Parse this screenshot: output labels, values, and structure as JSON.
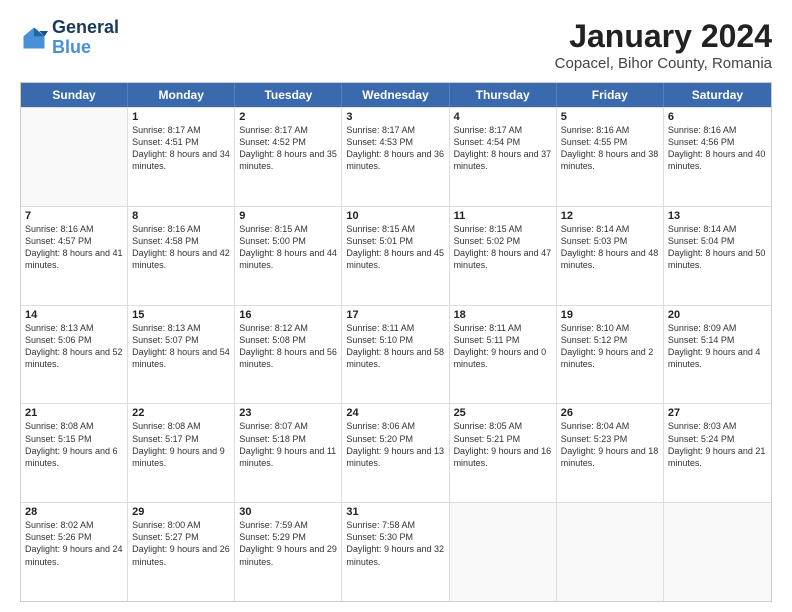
{
  "logo": {
    "line1": "General",
    "line2": "Blue"
  },
  "title": "January 2024",
  "subtitle": "Copacel, Bihor County, Romania",
  "header_days": [
    "Sunday",
    "Monday",
    "Tuesday",
    "Wednesday",
    "Thursday",
    "Friday",
    "Saturday"
  ],
  "weeks": [
    [
      {
        "day": "",
        "sunrise": "",
        "sunset": "",
        "daylight": ""
      },
      {
        "day": "1",
        "sunrise": "Sunrise: 8:17 AM",
        "sunset": "Sunset: 4:51 PM",
        "daylight": "Daylight: 8 hours and 34 minutes."
      },
      {
        "day": "2",
        "sunrise": "Sunrise: 8:17 AM",
        "sunset": "Sunset: 4:52 PM",
        "daylight": "Daylight: 8 hours and 35 minutes."
      },
      {
        "day": "3",
        "sunrise": "Sunrise: 8:17 AM",
        "sunset": "Sunset: 4:53 PM",
        "daylight": "Daylight: 8 hours and 36 minutes."
      },
      {
        "day": "4",
        "sunrise": "Sunrise: 8:17 AM",
        "sunset": "Sunset: 4:54 PM",
        "daylight": "Daylight: 8 hours and 37 minutes."
      },
      {
        "day": "5",
        "sunrise": "Sunrise: 8:16 AM",
        "sunset": "Sunset: 4:55 PM",
        "daylight": "Daylight: 8 hours and 38 minutes."
      },
      {
        "day": "6",
        "sunrise": "Sunrise: 8:16 AM",
        "sunset": "Sunset: 4:56 PM",
        "daylight": "Daylight: 8 hours and 40 minutes."
      }
    ],
    [
      {
        "day": "7",
        "sunrise": "Sunrise: 8:16 AM",
        "sunset": "Sunset: 4:57 PM",
        "daylight": "Daylight: 8 hours and 41 minutes."
      },
      {
        "day": "8",
        "sunrise": "Sunrise: 8:16 AM",
        "sunset": "Sunset: 4:58 PM",
        "daylight": "Daylight: 8 hours and 42 minutes."
      },
      {
        "day": "9",
        "sunrise": "Sunrise: 8:15 AM",
        "sunset": "Sunset: 5:00 PM",
        "daylight": "Daylight: 8 hours and 44 minutes."
      },
      {
        "day": "10",
        "sunrise": "Sunrise: 8:15 AM",
        "sunset": "Sunset: 5:01 PM",
        "daylight": "Daylight: 8 hours and 45 minutes."
      },
      {
        "day": "11",
        "sunrise": "Sunrise: 8:15 AM",
        "sunset": "Sunset: 5:02 PM",
        "daylight": "Daylight: 8 hours and 47 minutes."
      },
      {
        "day": "12",
        "sunrise": "Sunrise: 8:14 AM",
        "sunset": "Sunset: 5:03 PM",
        "daylight": "Daylight: 8 hours and 48 minutes."
      },
      {
        "day": "13",
        "sunrise": "Sunrise: 8:14 AM",
        "sunset": "Sunset: 5:04 PM",
        "daylight": "Daylight: 8 hours and 50 minutes."
      }
    ],
    [
      {
        "day": "14",
        "sunrise": "Sunrise: 8:13 AM",
        "sunset": "Sunset: 5:06 PM",
        "daylight": "Daylight: 8 hours and 52 minutes."
      },
      {
        "day": "15",
        "sunrise": "Sunrise: 8:13 AM",
        "sunset": "Sunset: 5:07 PM",
        "daylight": "Daylight: 8 hours and 54 minutes."
      },
      {
        "day": "16",
        "sunrise": "Sunrise: 8:12 AM",
        "sunset": "Sunset: 5:08 PM",
        "daylight": "Daylight: 8 hours and 56 minutes."
      },
      {
        "day": "17",
        "sunrise": "Sunrise: 8:11 AM",
        "sunset": "Sunset: 5:10 PM",
        "daylight": "Daylight: 8 hours and 58 minutes."
      },
      {
        "day": "18",
        "sunrise": "Sunrise: 8:11 AM",
        "sunset": "Sunset: 5:11 PM",
        "daylight": "Daylight: 9 hours and 0 minutes."
      },
      {
        "day": "19",
        "sunrise": "Sunrise: 8:10 AM",
        "sunset": "Sunset: 5:12 PM",
        "daylight": "Daylight: 9 hours and 2 minutes."
      },
      {
        "day": "20",
        "sunrise": "Sunrise: 8:09 AM",
        "sunset": "Sunset: 5:14 PM",
        "daylight": "Daylight: 9 hours and 4 minutes."
      }
    ],
    [
      {
        "day": "21",
        "sunrise": "Sunrise: 8:08 AM",
        "sunset": "Sunset: 5:15 PM",
        "daylight": "Daylight: 9 hours and 6 minutes."
      },
      {
        "day": "22",
        "sunrise": "Sunrise: 8:08 AM",
        "sunset": "Sunset: 5:17 PM",
        "daylight": "Daylight: 9 hours and 9 minutes."
      },
      {
        "day": "23",
        "sunrise": "Sunrise: 8:07 AM",
        "sunset": "Sunset: 5:18 PM",
        "daylight": "Daylight: 9 hours and 11 minutes."
      },
      {
        "day": "24",
        "sunrise": "Sunrise: 8:06 AM",
        "sunset": "Sunset: 5:20 PM",
        "daylight": "Daylight: 9 hours and 13 minutes."
      },
      {
        "day": "25",
        "sunrise": "Sunrise: 8:05 AM",
        "sunset": "Sunset: 5:21 PM",
        "daylight": "Daylight: 9 hours and 16 minutes."
      },
      {
        "day": "26",
        "sunrise": "Sunrise: 8:04 AM",
        "sunset": "Sunset: 5:23 PM",
        "daylight": "Daylight: 9 hours and 18 minutes."
      },
      {
        "day": "27",
        "sunrise": "Sunrise: 8:03 AM",
        "sunset": "Sunset: 5:24 PM",
        "daylight": "Daylight: 9 hours and 21 minutes."
      }
    ],
    [
      {
        "day": "28",
        "sunrise": "Sunrise: 8:02 AM",
        "sunset": "Sunset: 5:26 PM",
        "daylight": "Daylight: 9 hours and 24 minutes."
      },
      {
        "day": "29",
        "sunrise": "Sunrise: 8:00 AM",
        "sunset": "Sunset: 5:27 PM",
        "daylight": "Daylight: 9 hours and 26 minutes."
      },
      {
        "day": "30",
        "sunrise": "Sunrise: 7:59 AM",
        "sunset": "Sunset: 5:29 PM",
        "daylight": "Daylight: 9 hours and 29 minutes."
      },
      {
        "day": "31",
        "sunrise": "Sunrise: 7:58 AM",
        "sunset": "Sunset: 5:30 PM",
        "daylight": "Daylight: 9 hours and 32 minutes."
      },
      {
        "day": "",
        "sunrise": "",
        "sunset": "",
        "daylight": ""
      },
      {
        "day": "",
        "sunrise": "",
        "sunset": "",
        "daylight": ""
      },
      {
        "day": "",
        "sunrise": "",
        "sunset": "",
        "daylight": ""
      }
    ]
  ]
}
